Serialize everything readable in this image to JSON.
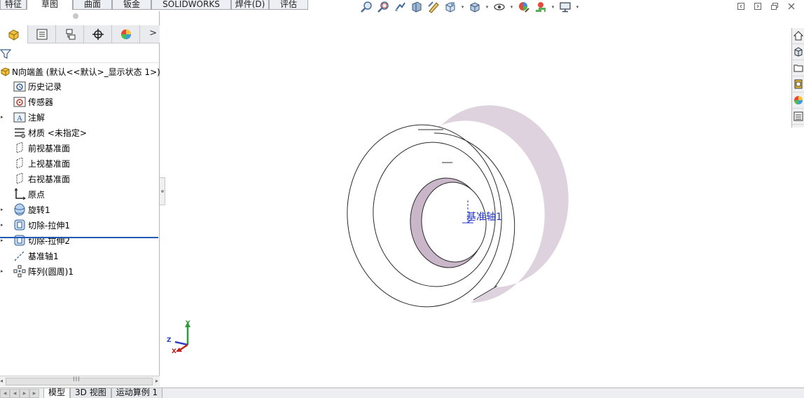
{
  "command_tabs": [
    {
      "label": "特征",
      "active": false
    },
    {
      "label": "草图",
      "active": true
    },
    {
      "label": "曲面",
      "active": false
    },
    {
      "label": "钣金",
      "active": false
    },
    {
      "label": "SOLIDWORKS MBD",
      "active": false
    },
    {
      "label": "焊件(D)",
      "active": false
    },
    {
      "label": "评估",
      "active": false
    }
  ],
  "heads_up_toolbar": [
    "zoom-to-fit-icon",
    "zoom-to-area-icon",
    "previous-view-icon",
    "section-view-icon",
    "dynamic-annotation-icon",
    "view-orientation-icon",
    "display-style-icon",
    "hide-show-items-icon",
    "edit-appearance-icon",
    "apply-scene-icon",
    "view-settings-icon"
  ],
  "manager_tabs": [
    {
      "name": "featuremanager-tab",
      "icon": "featuremanager-icon",
      "active": true
    },
    {
      "name": "propertymanager-tab",
      "icon": "propertymanager-icon",
      "active": false
    },
    {
      "name": "configurationmanager-tab",
      "icon": "configurationmanager-icon",
      "active": false
    },
    {
      "name": "dimxpert-tab",
      "icon": "dimxpert-icon",
      "active": false
    },
    {
      "name": "displaymanager-tab",
      "icon": "displaymanager-icon",
      "active": false
    }
  ],
  "tree": {
    "root_label": "N向端盖 (默认<<默认>_显示状态 1>)",
    "items": [
      {
        "label": "历史记录",
        "icon": "history-folder-icon",
        "expandable": false
      },
      {
        "label": "传感器",
        "icon": "sensors-folder-icon",
        "expandable": false
      },
      {
        "label": "注解",
        "icon": "annotations-icon",
        "expandable": true
      },
      {
        "label": "材质 <未指定>",
        "icon": "material-icon",
        "expandable": false
      },
      {
        "label": "前视基准面",
        "icon": "plane-icon",
        "expandable": false
      },
      {
        "label": "上视基准面",
        "icon": "plane-icon",
        "expandable": false
      },
      {
        "label": "右视基准面",
        "icon": "plane-icon",
        "expandable": false
      },
      {
        "label": "原点",
        "icon": "origin-icon",
        "expandable": false
      },
      {
        "label": "旋转1",
        "icon": "revolve-feature-icon",
        "expandable": true
      },
      {
        "label": "切除-拉伸1",
        "icon": "cut-extrude-icon",
        "expandable": true
      },
      {
        "label": "切除-拉伸2",
        "icon": "cut-extrude-icon",
        "expandable": true
      },
      {
        "label": "基准轴1",
        "icon": "reference-axis-icon",
        "expandable": false
      },
      {
        "label": "阵列(圆周)1",
        "icon": "circular-pattern-icon",
        "expandable": true
      }
    ]
  },
  "graphics": {
    "axis_label": "基准轴1",
    "triad": {
      "y": "Y",
      "z": "Z",
      "x": "X"
    }
  },
  "task_pane": [
    "solidworks-resources-icon",
    "design-library-icon",
    "file-explorer-icon",
    "view-palette-icon",
    "appearances-scenes-icon",
    "custom-properties-icon"
  ],
  "bottom_tabs": [
    {
      "label": "模型",
      "active": true
    },
    {
      "label": "3D 视图",
      "active": false
    },
    {
      "label": "运动算例 1",
      "active": false
    }
  ],
  "colors": {
    "rollback_bar": "#1f5bb6",
    "part_inner_face": "#c9b6c9",
    "axis_blue": "#2233cc"
  }
}
